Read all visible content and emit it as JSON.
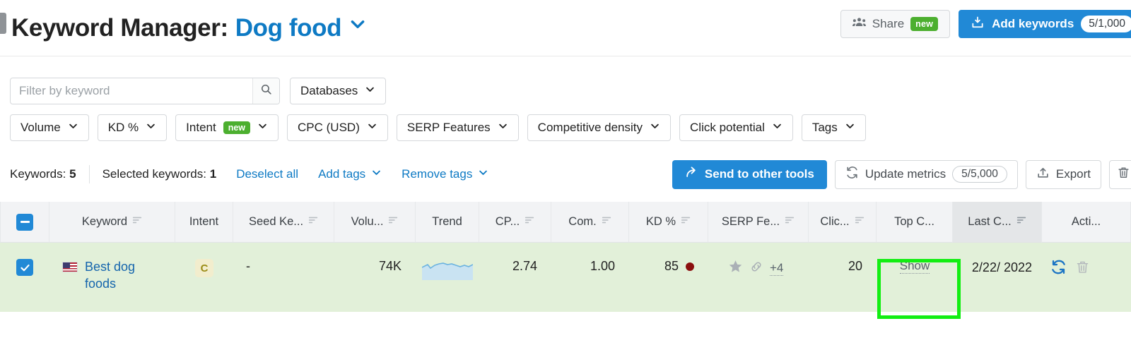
{
  "header": {
    "title_prefix": "Keyword Manager:",
    "project_name": "Dog food",
    "project_caret_icon": "chevron-down-icon",
    "share": {
      "label": "Share",
      "badge": "new",
      "icon": "people-icon"
    },
    "add_keywords": {
      "label": "Add keywords",
      "count": "5/1,000",
      "icon": "download-box-icon"
    }
  },
  "filters": {
    "search": {
      "placeholder": "Filter by keyword",
      "value": "",
      "icon": "search-icon"
    },
    "databases": {
      "label": "Databases",
      "icon": "chevron-down-icon"
    },
    "chips": [
      {
        "label": "Volume",
        "badge": ""
      },
      {
        "label": "KD %",
        "badge": ""
      },
      {
        "label": "Intent",
        "badge": "new"
      },
      {
        "label": "CPC (USD)",
        "badge": ""
      },
      {
        "label": "SERP Features",
        "badge": ""
      },
      {
        "label": "Competitive density",
        "badge": ""
      },
      {
        "label": "Click potential",
        "badge": ""
      },
      {
        "label": "Tags",
        "badge": ""
      }
    ]
  },
  "toolbar": {
    "keywords_label": "Keywords:",
    "keywords_count": "5",
    "selected_label": "Selected keywords:",
    "selected_count": "1",
    "deselect_all": "Deselect all",
    "add_tags": "Add tags",
    "remove_tags": "Remove tags",
    "send_to_other_tools": "Send to other tools",
    "update_metrics": "Update metrics",
    "update_metrics_count": "5/5,000",
    "export": "Export",
    "delete_icon": "trash-icon"
  },
  "table": {
    "columns": [
      {
        "label": "",
        "sortable": false,
        "name": "select-all"
      },
      {
        "label": "Keyword",
        "sortable": true
      },
      {
        "label": "Intent",
        "sortable": false
      },
      {
        "label": "Seed Ke...",
        "sortable": true
      },
      {
        "label": "Volu...",
        "sortable": true
      },
      {
        "label": "Trend",
        "sortable": false
      },
      {
        "label": "CP...",
        "sortable": true
      },
      {
        "label": "Com.",
        "sortable": true
      },
      {
        "label": "KD %",
        "sortable": true
      },
      {
        "label": "SERP Fe...",
        "sortable": true
      },
      {
        "label": "Clic...",
        "sortable": true
      },
      {
        "label": "Top C...",
        "sortable": false
      },
      {
        "label": "Last C...",
        "sortable": true,
        "highlighted": true
      },
      {
        "label": "Acti...",
        "sortable": false
      }
    ],
    "rows": [
      {
        "selected": true,
        "country_flag": "us-flag-icon",
        "keyword": "Best dog foods",
        "intent": "C",
        "seed_keyword": "-",
        "volume": "74K",
        "trend": "sparkline",
        "cpc": "2.74",
        "competition": "1.00",
        "kd": "85",
        "kd_color": "#8b0f0f",
        "serp_features": [
          "star-icon",
          "link-icon"
        ],
        "serp_more": "+4",
        "click_potential": "20",
        "top_competitors": "Show",
        "last_checked": "2/22/ 2022",
        "actions": [
          "refresh-icon",
          "trash-icon"
        ]
      }
    ]
  },
  "annotations": {
    "highlight_target": "Top C... Show cell",
    "highlight_color": "#12ee12"
  }
}
